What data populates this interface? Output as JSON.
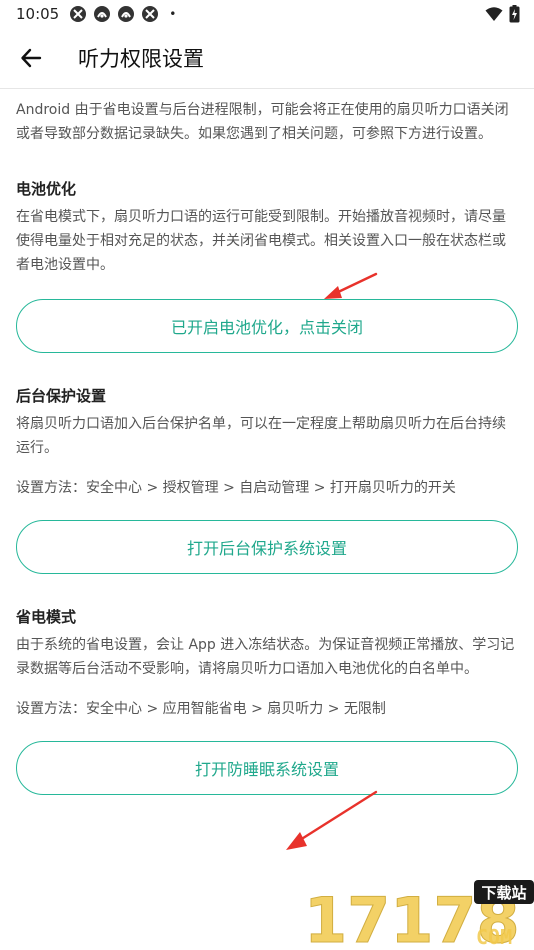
{
  "status_bar": {
    "time": "10:05",
    "dot": "•"
  },
  "header": {
    "title": "听力权限设置"
  },
  "intro": "Android 由于省电设置与后台进程限制，可能会将正在使用的扇贝听力口语关闭或者导致部分数据记录缺失。如果您遇到了相关问题，可参照下方进行设置。",
  "sections": [
    {
      "title": "电池优化",
      "desc": "在省电模式下，扇贝听力口语的运行可能受到限制。开始播放音视频时，请尽量使得电量处于相对充足的状态，并关闭省电模式。相关设置入口一般在状态栏或者电池设置中。",
      "button": "已开启电池优化，点击关闭"
    },
    {
      "title": "后台保护设置",
      "desc": "将扇贝听力口语加入后台保护名单，可以在一定程度上帮助扇贝听力在后台持续运行。",
      "method": "设置方法：安全中心 > 授权管理 > 自启动管理 > 打开扇贝听力的开关",
      "button": "打开后台保护系统设置"
    },
    {
      "title": "省电模式",
      "desc": "由于系统的省电设置，会让 App 进入冻结状态。为保证音视频正常播放、学习记录数据等后台活动不受影响，请将扇贝听力口语加入电池优化的白名单中。",
      "method": "设置方法：安全中心 > 应用智能省电 > 扇贝听力 > 无限制",
      "button": "打开防睡眠系统设置"
    }
  ],
  "watermark": {
    "digits": "17178",
    "tag": "下载站",
    "domain": "COM"
  },
  "colors": {
    "accent": "#27b89a",
    "annotation_arrow": "#e8322b"
  }
}
